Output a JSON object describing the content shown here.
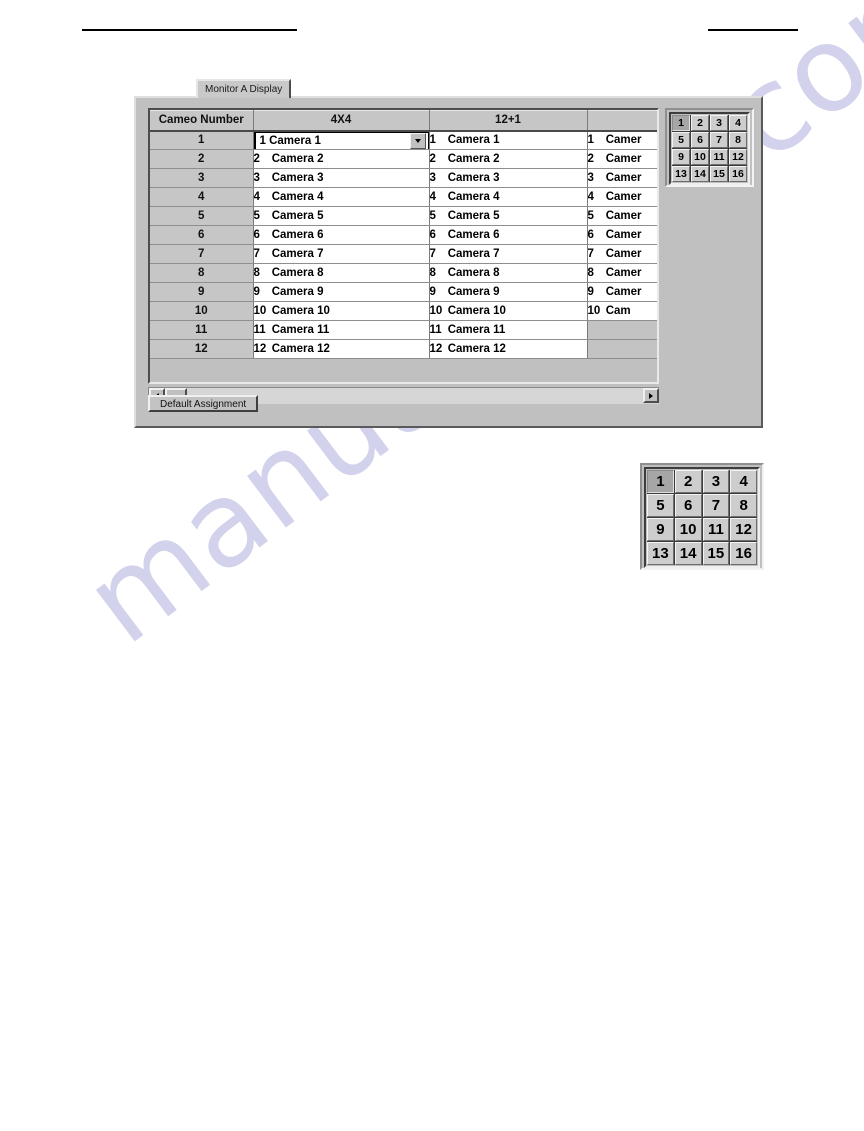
{
  "page": {
    "watermark": "manualshive.com",
    "header_rules": [
      "redaction-rule-left",
      "redaction-rule-right"
    ]
  },
  "dialog": {
    "tab": {
      "label": "Monitor A Display"
    },
    "table": {
      "headers": [
        "Cameo Number",
        "4X4",
        "12+1",
        ""
      ],
      "rows": [
        {
          "cameo": "1",
          "col_4x4_num": "1",
          "col_4x4_text": "Camera 1",
          "col_12p1_num": "1",
          "col_12p1_text": "Camera 1",
          "col_3_num": "1",
          "col_3_text": "Camer"
        },
        {
          "cameo": "2",
          "col_4x4_num": "2",
          "col_4x4_text": "Camera 2",
          "col_12p1_num": "2",
          "col_12p1_text": "Camera 2",
          "col_3_num": "2",
          "col_3_text": "Camer"
        },
        {
          "cameo": "3",
          "col_4x4_num": "3",
          "col_4x4_text": "Camera 3",
          "col_12p1_num": "3",
          "col_12p1_text": "Camera 3",
          "col_3_num": "3",
          "col_3_text": "Camer"
        },
        {
          "cameo": "4",
          "col_4x4_num": "4",
          "col_4x4_text": "Camera 4",
          "col_12p1_num": "4",
          "col_12p1_text": "Camera 4",
          "col_3_num": "4",
          "col_3_text": "Camer"
        },
        {
          "cameo": "5",
          "col_4x4_num": "5",
          "col_4x4_text": "Camera 5",
          "col_12p1_num": "5",
          "col_12p1_text": "Camera 5",
          "col_3_num": "5",
          "col_3_text": "Camer"
        },
        {
          "cameo": "6",
          "col_4x4_num": "6",
          "col_4x4_text": "Camera 6",
          "col_12p1_num": "6",
          "col_12p1_text": "Camera 6",
          "col_3_num": "6",
          "col_3_text": "Camer"
        },
        {
          "cameo": "7",
          "col_4x4_num": "7",
          "col_4x4_text": "Camera 7",
          "col_12p1_num": "7",
          "col_12p1_text": "Camera 7",
          "col_3_num": "7",
          "col_3_text": "Camer"
        },
        {
          "cameo": "8",
          "col_4x4_num": "8",
          "col_4x4_text": "Camera 8",
          "col_12p1_num": "8",
          "col_12p1_text": "Camera 8",
          "col_3_num": "8",
          "col_3_text": "Camer"
        },
        {
          "cameo": "9",
          "col_4x4_num": "9",
          "col_4x4_text": "Camera 9",
          "col_12p1_num": "9",
          "col_12p1_text": "Camera 9",
          "col_3_num": "9",
          "col_3_text": "Camer"
        },
        {
          "cameo": "10",
          "col_4x4_num": "10",
          "col_4x4_text": "Camera 10",
          "col_12p1_num": "10",
          "col_12p1_text": "Camera 10",
          "col_3_num": "10",
          "col_3_text": "Cam"
        },
        {
          "cameo": "11",
          "col_4x4_num": "11",
          "col_4x4_text": "Camera 11",
          "col_12p1_num": "11",
          "col_12p1_text": "Camera 11",
          "col_3_num": "",
          "col_3_text": ""
        },
        {
          "cameo": "12",
          "col_4x4_num": "12",
          "col_4x4_text": "Camera 12",
          "col_12p1_num": "12",
          "col_12p1_text": "Camera 12",
          "col_3_num": "",
          "col_3_text": ""
        }
      ]
    },
    "combobox": {
      "value": "1  Camera 1",
      "arrow": "chevron-down-icon"
    },
    "default_button": {
      "label": "Default Assignment"
    },
    "scrollbars": {
      "vertical_up": "scroll-up-arrow",
      "vertical_down": "scroll-down-arrow",
      "horizontal_left": "scroll-left-arrow",
      "horizontal_right": "scroll-right-arrow"
    },
    "cameo_grid_small": {
      "cells": [
        "1",
        "2",
        "3",
        "4",
        "5",
        "6",
        "7",
        "8",
        "9",
        "10",
        "11",
        "12",
        "13",
        "14",
        "15",
        "16"
      ],
      "selected": "1"
    }
  },
  "cameo_grid_large": {
    "cells": [
      "1",
      "2",
      "3",
      "4",
      "5",
      "6",
      "7",
      "8",
      "9",
      "10",
      "11",
      "12",
      "13",
      "14",
      "15",
      "16"
    ],
    "selected": "1"
  },
  "colors": {
    "dialog_face": "#c0c0c0",
    "cell_white": "#ffffff",
    "header_gray": "#c6c6c6",
    "selected_cell": "#a6a6a6",
    "watermark": "#c9c7e8"
  }
}
